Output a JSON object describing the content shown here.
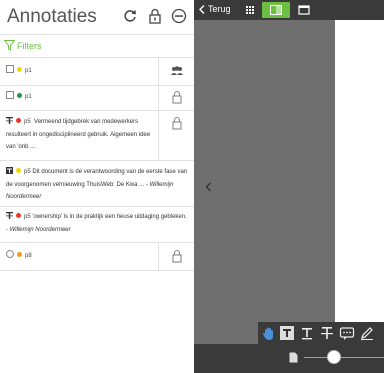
{
  "sidebar": {
    "title": "Annotaties",
    "filters_label": "Filters",
    "annotations": [
      {
        "name": "p1",
        "text": "",
        "author": ""
      },
      {
        "name": "p1",
        "text": "",
        "author": ""
      },
      {
        "name": "p5",
        "text": "Vermeend tijdgebrek van medewerkers resulteert in ongedisciplineerd gebruik.   Algemeen idee van 'onb ...",
        "author": ""
      },
      {
        "name": "p5",
        "text": "Dit document is de verantwoording van de eerste fase van de voorgenomen vernieuwing ThuisWeb: De Kwa ...",
        "author": "Willemijn Noordermeer"
      },
      {
        "name": "p5",
        "text": "'ownership' is in de praktijk een heuse uitdaging gebleken.",
        "author": "Willemijn Noordermeer"
      },
      {
        "name": "p8",
        "text": "",
        "author": ""
      }
    ],
    "author_separator": " - "
  },
  "viewer": {
    "back_label": "Terug"
  },
  "colors": {
    "accent_green": "#6cbf43",
    "dot_yellow": "#f4d600",
    "dot_green": "#1d9a3a",
    "dot_red": "#e8382c",
    "dot_orange": "#f29a1e"
  },
  "icons": [
    "refresh-icon",
    "lock-icon",
    "minus-circle-icon",
    "filter-icon",
    "users-icon",
    "strikethrough-icon",
    "highlight-text-icon",
    "hand-icon",
    "text-icon",
    "comment-icon",
    "pen-icon",
    "page-icon"
  ]
}
